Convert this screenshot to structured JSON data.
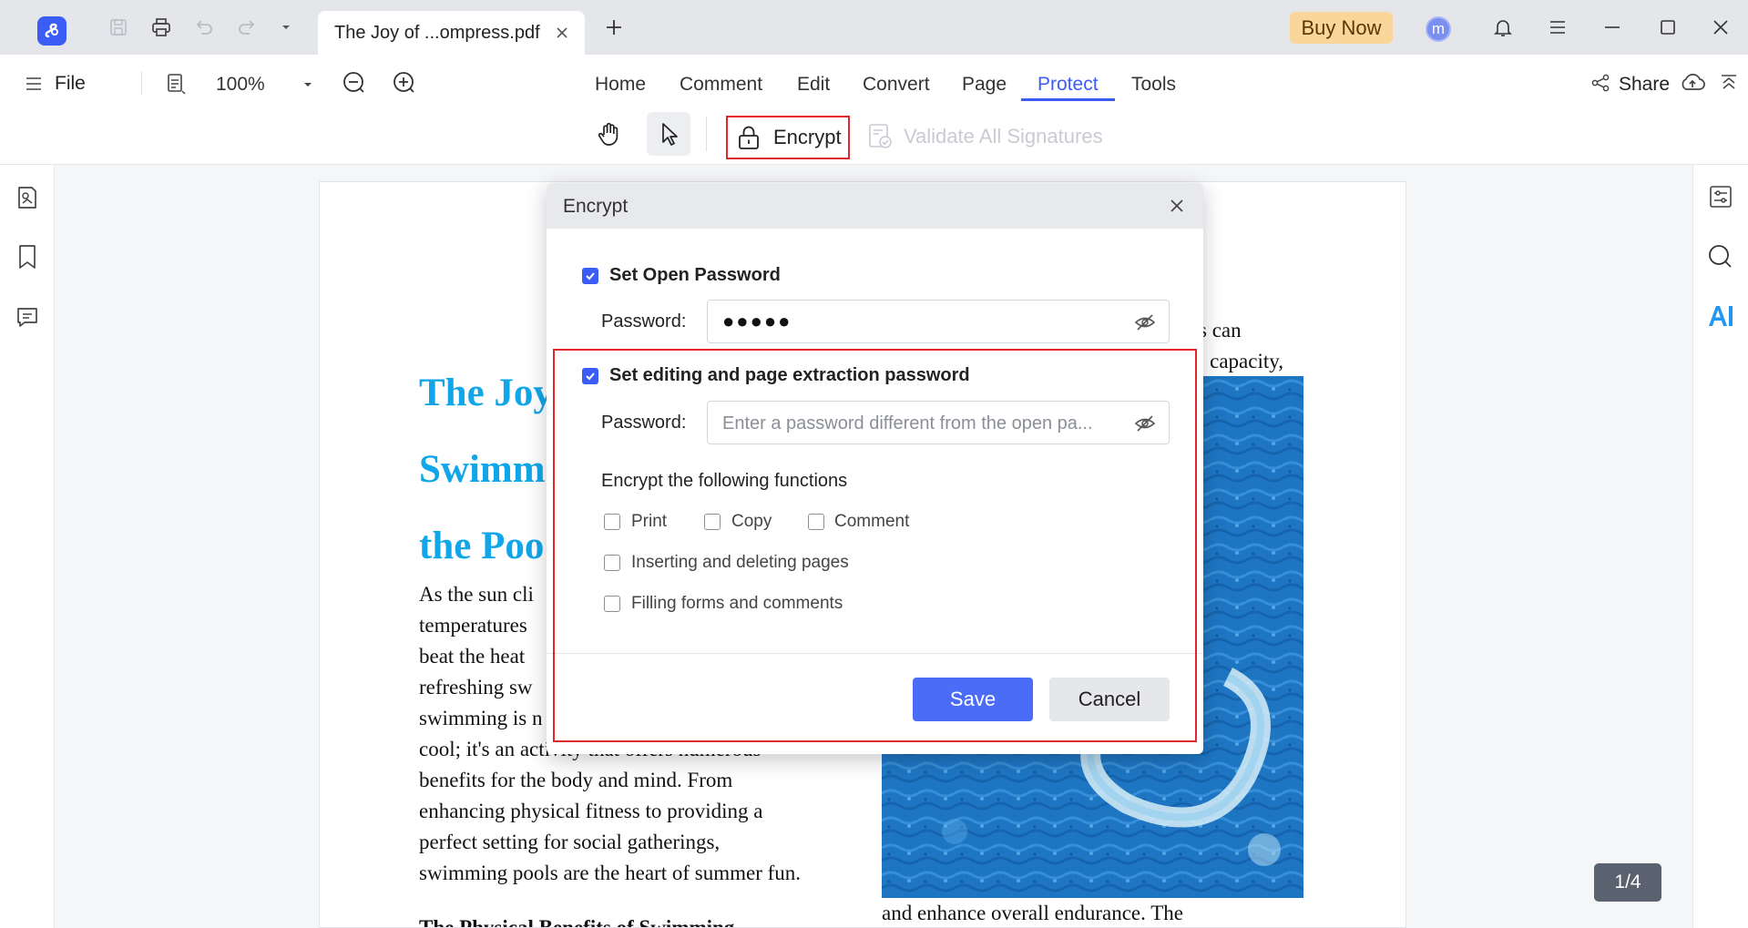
{
  "tabbar": {
    "doc_tab_title": "The Joy of ...ompress.pdf",
    "buy_now": "Buy Now",
    "avatar_letter": "m"
  },
  "toolbar": {
    "file": "File",
    "zoom": "100%",
    "menu_tabs": [
      "Home",
      "Comment",
      "Edit",
      "Convert",
      "Page",
      "Protect",
      "Tools"
    ],
    "active_tab": "Protect",
    "share": "Share",
    "encrypt": "Encrypt",
    "validate": "Validate All Signatures"
  },
  "document": {
    "title_lines": [
      "The Joy",
      "Swimm",
      "the Poo"
    ],
    "body_lines": [
      "As the sun cli",
      "temperatures",
      "beat the heat",
      "refreshing sw",
      "swimming is n",
      "cool; it's an activity that offers numerous",
      "benefits for the body and mind. From",
      "enhancing physical fitness to providing a",
      "perfect setting for social gatherings,",
      "swimming pools are the heart of summer fun."
    ],
    "right_col_line1": "s can",
    "right_col_line2": "; capacity,",
    "right_col_bottom": "and enhance overall endurance. The",
    "next_heading": "The Physical Benefits of Swimming"
  },
  "page_counter": "1/4",
  "dialog": {
    "title": "Encrypt",
    "open_password": {
      "label": "Set Open Password",
      "checked": true,
      "field_label": "Password:",
      "value": "●●●●●"
    },
    "edit_password": {
      "label": "Set editing and page extraction password",
      "checked": true,
      "field_label": "Password:",
      "placeholder": "Enter a password different from the open pa..."
    },
    "functions_heading": "Encrypt the following functions",
    "functions": {
      "print": "Print",
      "copy": "Copy",
      "comment": "Comment",
      "insert_delete": "Inserting and deleting pages",
      "fill_forms": "Filling forms and comments"
    },
    "save": "Save",
    "cancel": "Cancel"
  },
  "colors": {
    "accent": "#3b5df5",
    "title_blue": "#11a6e8",
    "highlight_red": "#e0262e"
  }
}
